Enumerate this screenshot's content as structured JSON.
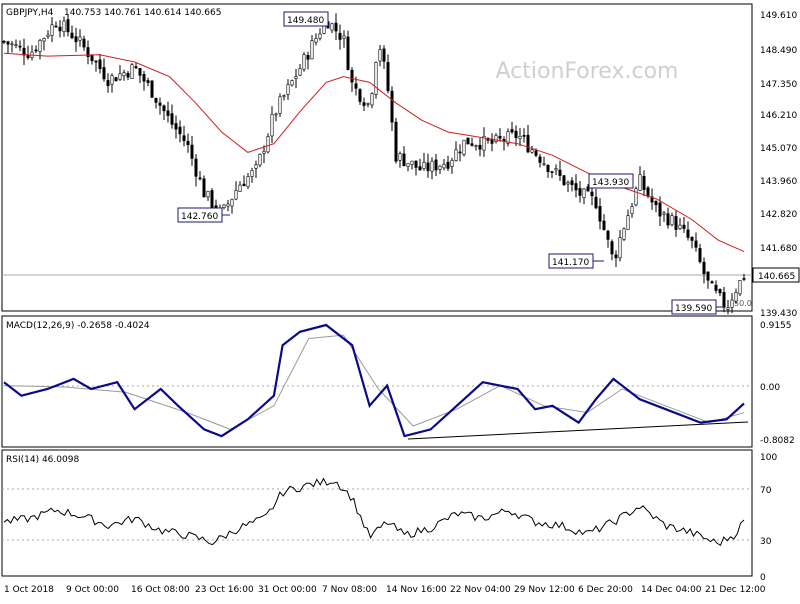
{
  "header": {
    "instrument": "GBPJPY,H4",
    "ohlc": "140.753 140.761 140.614 140.665",
    "watermark": "ActionForex.com"
  },
  "price_panel": {
    "current_price": "140.665",
    "level_tag": "50.0",
    "y_ticks": [
      "149.610",
      "148.490",
      "147.350",
      "146.210",
      "145.070",
      "143.960",
      "142.820",
      "141.680",
      "140.665",
      "139.430"
    ],
    "annotations": [
      "149.480",
      "143.930",
      "142.760",
      "141.170",
      "139.590"
    ]
  },
  "macd_panel": {
    "title": "MACD(12,26,9) -0.2658 -0.4024",
    "y_ticks": [
      "0.9155",
      "0.00",
      "-0.8082"
    ]
  },
  "rsi_panel": {
    "title": "RSI(14) 46.0098",
    "y_ticks": [
      "100",
      "70",
      "30",
      "0"
    ]
  },
  "x_axis": {
    "labels": [
      "1 Oct 2018",
      "9 Oct 00:00",
      "16 Oct 08:00",
      "23 Oct 16:00",
      "31 Oct 00:00",
      "7 Nov 08:00",
      "14 Nov 16:00",
      "22 Nov 04:00",
      "29 Nov 12:00",
      "6 Dec 20:00",
      "14 Dec 04:00",
      "21 Dec 12:00"
    ]
  },
  "colors": {
    "candles": "#000000",
    "moving_average": "#cc1f1f",
    "macd_line": "#0a0a8c",
    "signal_line": "#9a9a9a",
    "annotation_box": "#1a1a6e",
    "grid_line": "#aaaaaa"
  },
  "chart_data": [
    {
      "type": "candlestick",
      "title": "GBPJPY,H4",
      "x_range": [
        "2018-10-01",
        "2018-12-25"
      ],
      "ylim": [
        139.43,
        149.61
      ],
      "y_axis_side": "right",
      "series": [
        {
          "name": "price_path",
          "points": [
            {
              "x": "2018-10-01",
              "y": 148.7
            },
            {
              "x": "2018-10-04",
              "y": 148.3
            },
            {
              "x": "2018-10-07",
              "y": 149.4
            },
            {
              "x": "2018-10-09",
              "y": 148.9
            },
            {
              "x": "2018-10-11",
              "y": 148.2
            },
            {
              "x": "2018-10-13",
              "y": 147.4
            },
            {
              "x": "2018-10-16",
              "y": 147.8
            },
            {
              "x": "2018-10-18",
              "y": 147.0
            },
            {
              "x": "2018-10-20",
              "y": 146.0
            },
            {
              "x": "2018-10-22",
              "y": 145.2
            },
            {
              "x": "2018-10-24",
              "y": 143.5
            },
            {
              "x": "2018-10-26",
              "y": 142.76
            },
            {
              "x": "2018-10-28",
              "y": 143.8
            },
            {
              "x": "2018-10-30",
              "y": 144.3
            },
            {
              "x": "2018-11-01",
              "y": 146.2
            },
            {
              "x": "2018-11-04",
              "y": 147.8
            },
            {
              "x": "2018-11-07",
              "y": 149.48
            },
            {
              "x": "2018-11-09",
              "y": 148.8
            },
            {
              "x": "2018-11-10",
              "y": 147.2
            },
            {
              "x": "2018-11-12",
              "y": 146.5
            },
            {
              "x": "2018-11-13",
              "y": 148.8
            },
            {
              "x": "2018-11-14",
              "y": 147.3
            },
            {
              "x": "2018-11-15",
              "y": 144.8
            },
            {
              "x": "2018-11-18",
              "y": 144.3
            },
            {
              "x": "2018-11-21",
              "y": 144.6
            },
            {
              "x": "2018-11-23",
              "y": 145.3
            },
            {
              "x": "2018-11-26",
              "y": 145.2
            },
            {
              "x": "2018-11-29",
              "y": 145.5
            },
            {
              "x": "2018-12-01",
              "y": 144.9
            },
            {
              "x": "2018-12-04",
              "y": 144.0
            },
            {
              "x": "2018-12-06",
              "y": 143.5
            },
            {
              "x": "2018-12-08",
              "y": 143.2
            },
            {
              "x": "2018-12-10",
              "y": 141.17
            },
            {
              "x": "2018-12-11",
              "y": 142.2
            },
            {
              "x": "2018-12-13",
              "y": 143.93
            },
            {
              "x": "2018-12-15",
              "y": 142.9
            },
            {
              "x": "2018-12-17",
              "y": 142.5
            },
            {
              "x": "2018-12-19",
              "y": 141.8
            },
            {
              "x": "2018-12-21",
              "y": 140.3
            },
            {
              "x": "2018-12-23",
              "y": 139.59
            },
            {
              "x": "2018-12-24",
              "y": 140.2
            },
            {
              "x": "2018-12-25",
              "y": 140.665
            }
          ]
        },
        {
          "name": "moving_average",
          "points": [
            {
              "x": "2018-10-01",
              "y": 148.3
            },
            {
              "x": "2018-10-06",
              "y": 148.2
            },
            {
              "x": "2018-10-12",
              "y": 148.25
            },
            {
              "x": "2018-10-16",
              "y": 148.0
            },
            {
              "x": "2018-10-20",
              "y": 147.5
            },
            {
              "x": "2018-10-23",
              "y": 146.6
            },
            {
              "x": "2018-10-26",
              "y": 145.6
            },
            {
              "x": "2018-10-29",
              "y": 144.9
            },
            {
              "x": "2018-11-01",
              "y": 145.2
            },
            {
              "x": "2018-11-04",
              "y": 146.3
            },
            {
              "x": "2018-11-07",
              "y": 147.3
            },
            {
              "x": "2018-11-09",
              "y": 147.5
            },
            {
              "x": "2018-11-12",
              "y": 147.3
            },
            {
              "x": "2018-11-15",
              "y": 146.6
            },
            {
              "x": "2018-11-18",
              "y": 146.0
            },
            {
              "x": "2018-11-21",
              "y": 145.6
            },
            {
              "x": "2018-11-25",
              "y": 145.4
            },
            {
              "x": "2018-11-29",
              "y": 145.2
            },
            {
              "x": "2018-12-03",
              "y": 144.8
            },
            {
              "x": "2018-12-07",
              "y": 144.2
            },
            {
              "x": "2018-12-11",
              "y": 143.7
            },
            {
              "x": "2018-12-15",
              "y": 143.3
            },
            {
              "x": "2018-12-19",
              "y": 142.6
            },
            {
              "x": "2018-12-22",
              "y": 141.9
            },
            {
              "x": "2018-12-25",
              "y": 141.5
            }
          ]
        }
      ],
      "horizontal_line": 140.665
    },
    {
      "type": "line",
      "title": "MACD(12,26,9) -0.2658 -0.4024",
      "ylim": [
        -0.8082,
        0.9155
      ],
      "zero_line": 0,
      "series": [
        {
          "name": "MACD",
          "points": [
            {
              "x": "2018-10-01",
              "y": 0.05
            },
            {
              "x": "2018-10-03",
              "y": -0.15
            },
            {
              "x": "2018-10-06",
              "y": -0.05
            },
            {
              "x": "2018-10-09",
              "y": 0.1
            },
            {
              "x": "2018-10-11",
              "y": -0.05
            },
            {
              "x": "2018-10-14",
              "y": 0.05
            },
            {
              "x": "2018-10-16",
              "y": -0.35
            },
            {
              "x": "2018-10-19",
              "y": -0.05
            },
            {
              "x": "2018-10-21",
              "y": -0.3
            },
            {
              "x": "2018-10-24",
              "y": -0.65
            },
            {
              "x": "2018-10-26",
              "y": -0.75
            },
            {
              "x": "2018-10-29",
              "y": -0.5
            },
            {
              "x": "2018-11-01",
              "y": -0.15
            },
            {
              "x": "2018-11-02",
              "y": 0.6
            },
            {
              "x": "2018-11-04",
              "y": 0.8
            },
            {
              "x": "2018-11-07",
              "y": 0.9
            },
            {
              "x": "2018-11-10",
              "y": 0.6
            },
            {
              "x": "2018-11-12",
              "y": -0.3
            },
            {
              "x": "2018-11-14",
              "y": 0.0
            },
            {
              "x": "2018-11-16",
              "y": -0.75
            },
            {
              "x": "2018-11-19",
              "y": -0.65
            },
            {
              "x": "2018-11-22",
              "y": -0.3
            },
            {
              "x": "2018-11-25",
              "y": 0.05
            },
            {
              "x": "2018-11-29",
              "y": -0.05
            },
            {
              "x": "2018-12-01",
              "y": -0.35
            },
            {
              "x": "2018-12-03",
              "y": -0.3
            },
            {
              "x": "2018-12-06",
              "y": -0.55
            },
            {
              "x": "2018-12-08",
              "y": -0.2
            },
            {
              "x": "2018-12-10",
              "y": 0.1
            },
            {
              "x": "2018-12-13",
              "y": -0.2
            },
            {
              "x": "2018-12-16",
              "y": -0.35
            },
            {
              "x": "2018-12-20",
              "y": -0.55
            },
            {
              "x": "2018-12-23",
              "y": -0.5
            },
            {
              "x": "2018-12-25",
              "y": -0.2658
            }
          ]
        },
        {
          "name": "Signal",
          "points": [
            {
              "x": "2018-10-01",
              "y": 0.0
            },
            {
              "x": "2018-10-08",
              "y": -0.02
            },
            {
              "x": "2018-10-15",
              "y": -0.1
            },
            {
              "x": "2018-10-22",
              "y": -0.4
            },
            {
              "x": "2018-10-27",
              "y": -0.65
            },
            {
              "x": "2018-11-01",
              "y": -0.3
            },
            {
              "x": "2018-11-05",
              "y": 0.7
            },
            {
              "x": "2018-11-09",
              "y": 0.75
            },
            {
              "x": "2018-11-13",
              "y": -0.05
            },
            {
              "x": "2018-11-17",
              "y": -0.6
            },
            {
              "x": "2018-11-22",
              "y": -0.35
            },
            {
              "x": "2018-11-27",
              "y": 0.0
            },
            {
              "x": "2018-12-02",
              "y": -0.3
            },
            {
              "x": "2018-12-07",
              "y": -0.4
            },
            {
              "x": "2018-12-11",
              "y": -0.05
            },
            {
              "x": "2018-12-16",
              "y": -0.3
            },
            {
              "x": "2018-12-21",
              "y": -0.55
            },
            {
              "x": "2018-12-25",
              "y": -0.4024
            }
          ]
        }
      ]
    },
    {
      "type": "line",
      "title": "RSI(14) 46.0098",
      "ylim": [
        0,
        100
      ],
      "levels": [
        70,
        30
      ],
      "series": [
        {
          "name": "RSI(14)",
          "points": [
            {
              "x": "2018-10-01",
              "y": 45
            },
            {
              "x": "2018-10-04",
              "y": 48
            },
            {
              "x": "2018-10-07",
              "y": 55
            },
            {
              "x": "2018-10-10",
              "y": 50
            },
            {
              "x": "2018-10-13",
              "y": 42
            },
            {
              "x": "2018-10-16",
              "y": 48
            },
            {
              "x": "2018-10-19",
              "y": 38
            },
            {
              "x": "2018-10-22",
              "y": 34
            },
            {
              "x": "2018-10-25",
              "y": 28
            },
            {
              "x": "2018-10-28",
              "y": 40
            },
            {
              "x": "2018-10-31",
              "y": 48
            },
            {
              "x": "2018-11-02",
              "y": 70
            },
            {
              "x": "2018-11-05",
              "y": 76
            },
            {
              "x": "2018-11-08",
              "y": 80
            },
            {
              "x": "2018-11-10",
              "y": 65
            },
            {
              "x": "2018-11-12",
              "y": 32
            },
            {
              "x": "2018-11-14",
              "y": 45
            },
            {
              "x": "2018-11-16",
              "y": 34
            },
            {
              "x": "2018-11-19",
              "y": 40
            },
            {
              "x": "2018-11-22",
              "y": 52
            },
            {
              "x": "2018-11-25",
              "y": 48
            },
            {
              "x": "2018-11-28",
              "y": 55
            },
            {
              "x": "2018-12-01",
              "y": 45
            },
            {
              "x": "2018-12-04",
              "y": 42
            },
            {
              "x": "2018-12-07",
              "y": 35
            },
            {
              "x": "2018-12-10",
              "y": 45
            },
            {
              "x": "2018-12-13",
              "y": 58
            },
            {
              "x": "2018-12-16",
              "y": 42
            },
            {
              "x": "2018-12-19",
              "y": 36
            },
            {
              "x": "2018-12-22",
              "y": 27
            },
            {
              "x": "2018-12-24",
              "y": 35
            },
            {
              "x": "2018-12-25",
              "y": 46.0098
            }
          ]
        }
      ]
    }
  ]
}
